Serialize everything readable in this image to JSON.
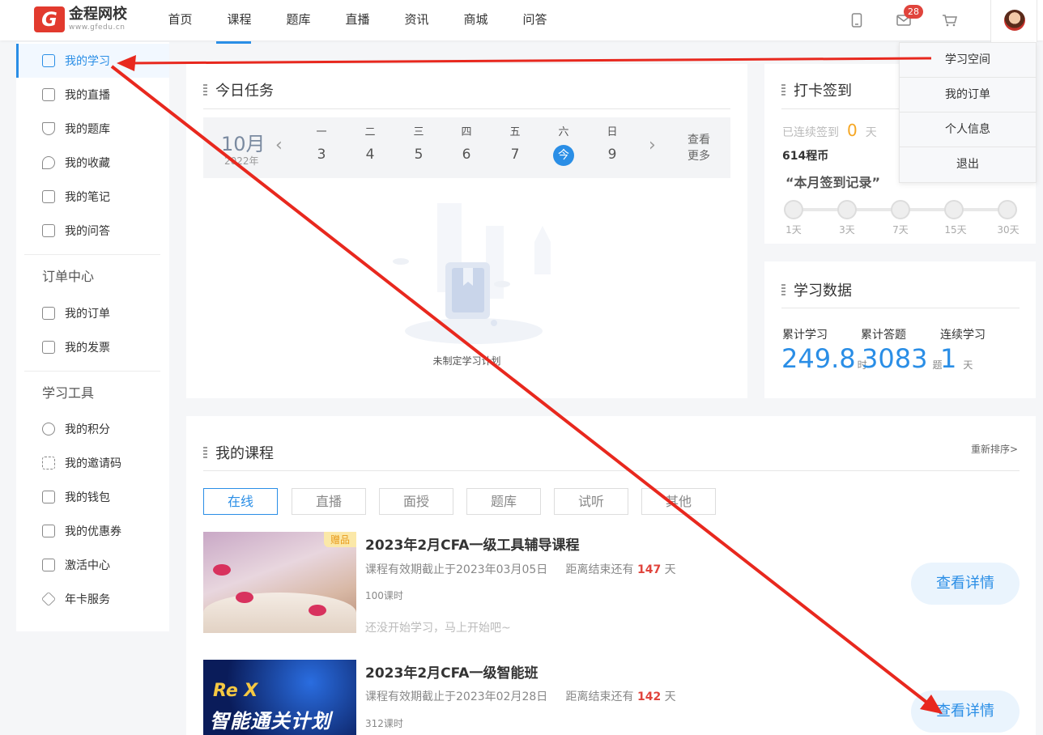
{
  "header": {
    "logo_name": "金程网校",
    "logo_url": "www.gfedu.cn",
    "nav": [
      "首页",
      "课程",
      "题库",
      "直播",
      "资讯",
      "商城",
      "问答"
    ],
    "active_nav": 1,
    "message_count": "28"
  },
  "dropdown": [
    "学习空间",
    "我的订单",
    "个人信息",
    "退出"
  ],
  "sidebar": {
    "items": [
      {
        "label": "我的学习",
        "icon": "book-icon",
        "active": true
      },
      {
        "label": "我的直播",
        "icon": "video-icon"
      },
      {
        "label": "我的题库",
        "icon": "cup-icon"
      },
      {
        "label": "我的收藏",
        "icon": "heart-icon"
      },
      {
        "label": "我的笔记",
        "icon": "edit-icon"
      },
      {
        "label": "我的问答",
        "icon": "chat-icon"
      }
    ],
    "order_section": "订单中心",
    "order_items": [
      {
        "label": "我的订单",
        "icon": "order-icon"
      },
      {
        "label": "我的发票",
        "icon": "invoice-icon"
      }
    ],
    "tools_section": "学习工具",
    "tools_items": [
      {
        "label": "我的积分",
        "icon": "points-icon"
      },
      {
        "label": "我的邀请码",
        "icon": "scan-icon"
      },
      {
        "label": "我的钱包",
        "icon": "wallet-icon"
      },
      {
        "label": "我的优惠券",
        "icon": "coupon-icon"
      },
      {
        "label": "激活中心",
        "icon": "card-icon"
      },
      {
        "label": "年卡服务",
        "icon": "layers-icon"
      }
    ]
  },
  "tasks": {
    "title": "今日任务",
    "month": "10月",
    "year": "2022年",
    "days": [
      {
        "wd": "一",
        "dn": "3"
      },
      {
        "wd": "二",
        "dn": "4"
      },
      {
        "wd": "三",
        "dn": "5"
      },
      {
        "wd": "四",
        "dn": "6"
      },
      {
        "wd": "五",
        "dn": "7"
      },
      {
        "wd": "六",
        "dn": "今"
      },
      {
        "wd": "日",
        "dn": "9"
      }
    ],
    "today_index": 5,
    "view_more": "查看更多",
    "empty": "未制定学习计划"
  },
  "checkin": {
    "title": "打卡签到",
    "streak_label": "已连续签到",
    "streak_value": "0",
    "streak_unit": "天",
    "coins": "614程币",
    "record_title": "“本月签到记录”",
    "milestones": [
      "1天",
      "3天",
      "7天",
      "15天",
      "30天"
    ]
  },
  "stats": {
    "title": "学习数据",
    "items": [
      {
        "label": "累计学习",
        "value": "249.8",
        "unit": "时"
      },
      {
        "label": "累计答题",
        "value": "3083",
        "unit": "题"
      },
      {
        "label": "连续学习",
        "value": "1",
        "unit": "天"
      }
    ]
  },
  "courses": {
    "title": "我的课程",
    "resort": "重新排序>",
    "tabs": [
      "在线",
      "直播",
      "面授",
      "题库",
      "试听",
      "其他"
    ],
    "active_tab": 0,
    "list": [
      {
        "title": "2023年2月CFA一级工具辅导课程",
        "gift": "赠品",
        "expire": "课程有效期截止于2023年03月05日",
        "remain_prefix": "距离结束还有",
        "remain_days": "147",
        "remain_unit": "天",
        "hours": "100课时",
        "hint": "还没开始学习，马上开始吧~",
        "button": "查看详情"
      },
      {
        "title": "2023年2月CFA一级智能班",
        "thumb_rex": "Re X",
        "thumb_title": "智能通关计划",
        "expire": "课程有效期截止于2023年02月28日",
        "remain_prefix": "距离结束还有",
        "remain_days": "142",
        "remain_unit": "天",
        "hours": "312课时",
        "button": "查看详情"
      }
    ]
  },
  "colors": {
    "accent": "#2a8ee6",
    "annotation": "#e8281e",
    "highlight": "#e0443c"
  }
}
